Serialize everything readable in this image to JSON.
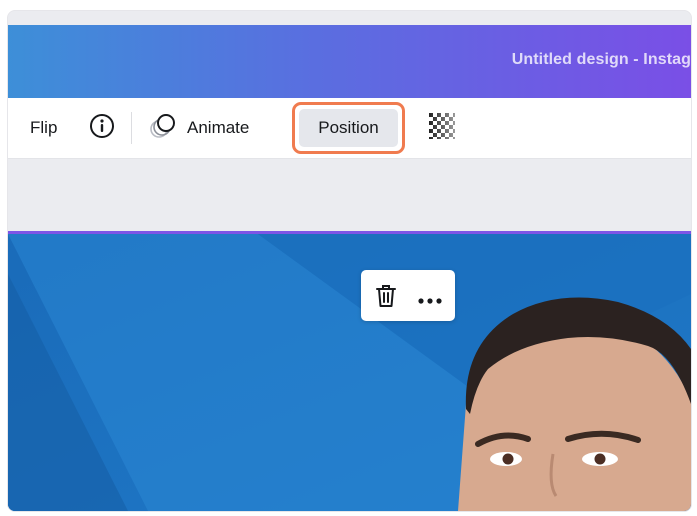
{
  "header": {
    "title": "Untitled design - Instag"
  },
  "toolbar": {
    "flip_label": "Flip",
    "info_icon": "info-circle-icon",
    "animate_icon": "animate-circles-icon",
    "animate_label": "Animate",
    "position_label": "Position",
    "transparency_icon": "transparency-checker-icon"
  },
  "canvas": {
    "image": "portrait photo of man on blue background"
  },
  "floating_menu": {
    "delete_icon": "trash-icon",
    "more_icon": "more-dots-icon"
  },
  "colors": {
    "header_start": "#3d8fd8",
    "header_end": "#7a4fe6",
    "highlight": "#f07b4f",
    "selection": "#7d55e6",
    "background": "#1f73c3"
  }
}
